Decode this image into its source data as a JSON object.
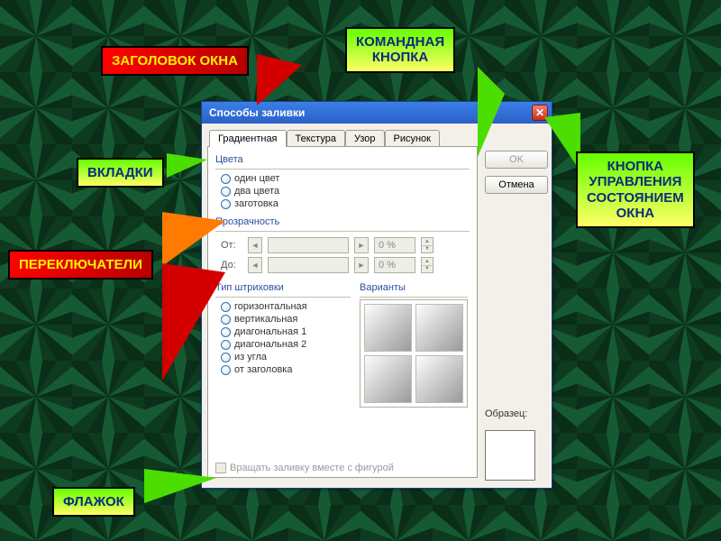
{
  "callouts": {
    "title_label": "ЗАГОЛОВОК ОКНА",
    "command_button": "КОМАНДНАЯ\nКНОПКА",
    "tabs_label": "ВКЛАДКИ",
    "window_state_button": "КНОПКА\nУПРАВЛЕНИЯ\nСОСТОЯНИЕМ\nОКНА",
    "radios_label": "ПЕРЕКЛЮЧАТЕЛИ",
    "checkbox_label": "ФЛАЖОК"
  },
  "dialog": {
    "title": "Способы заливки",
    "tabs": [
      "Градиентная",
      "Текстура",
      "Узор",
      "Рисунок"
    ],
    "active_tab_index": 0,
    "colors_group": {
      "title": "Цвета",
      "options": [
        "один цвет",
        "два цвета",
        "заготовка"
      ]
    },
    "transparency_group": {
      "title": "Прозрачность",
      "from_label": "От:",
      "to_label": "До:",
      "from_value": "0 %",
      "to_value": "0 %"
    },
    "hatching_group": {
      "title": "Тип штриховки",
      "options": [
        "горизонтальная",
        "вертикальная",
        "диагональная 1",
        "диагональная 2",
        "из угла",
        "от заголовка"
      ]
    },
    "variants_label": "Варианты",
    "ok_label": "OK",
    "cancel_label": "Отмена",
    "sample_label": "Образец:",
    "rotate_checkbox_label": "Вращать заливку вместе с фигурой"
  }
}
